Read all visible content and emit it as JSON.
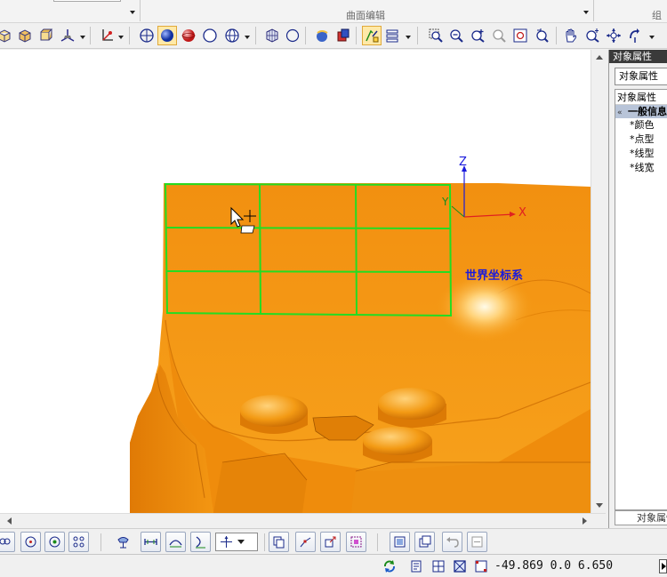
{
  "ribbon": {
    "group_surface_edit": "曲面编辑",
    "group_combine": "组合"
  },
  "toolbar": {
    "icons": [
      "box-wireframe-icon",
      "box-shaded-icon",
      "box-iso-icon",
      "axis-view-icon",
      "coordinate-system-icon",
      "render-icon",
      "sphere-shaded-icon",
      "sphere-red-icon",
      "sphere-outline-icon",
      "globe-icon",
      "cube-grid-icon",
      "sphere-small-icon",
      "texture-icon",
      "material-icon",
      "edit-select-icon",
      "layer-stack-icon",
      "zoom-window-icon",
      "zoom-out-icon",
      "zoom-in-icon",
      "zoom-disabled-icon",
      "zoom-fit-icon",
      "zoom-previous-icon",
      "pan-hand-icon",
      "dynamic-zoom-icon",
      "rotate-view-icon",
      "spin-view-icon"
    ],
    "active": "sphere-shaded-icon"
  },
  "viewport": {
    "coordinate_system_label": "世界坐标系",
    "axis_labels": {
      "z": "Z",
      "x": "X",
      "y": "Y"
    },
    "colors": {
      "part": "#f59a10",
      "grid": "#22dd22",
      "axis": "#1a1adc",
      "x_axis": "#e02020"
    }
  },
  "properties_panel": {
    "title": "对象属性",
    "tab_label": "对象属性",
    "header": "对象属性",
    "group_label": "一般信息",
    "items": [
      "*颜色",
      "*点型",
      "*线型",
      "*线宽"
    ],
    "bottom_tab": "对象属性"
  },
  "bottom_toolbar": {
    "icons": [
      "snap-points-icon",
      "snap-circle-icon",
      "snap-center-icon",
      "snap-grid-icon",
      "lamp-icon",
      "align-horizontal-icon",
      "align-curve-icon",
      "align-vertical-icon",
      "transform-combo-icon",
      "copy-icon",
      "node-edit-icon",
      "move-icon",
      "selection-icon",
      "view-icon",
      "window-icon",
      "undo-icon",
      "redo-icon"
    ]
  },
  "status_bar": {
    "coordinates": "-49.869 0.0 6.650",
    "icons": [
      "refresh-icon",
      "document-icon",
      "grid-toggle-icon",
      "box-toggle-icon",
      "ruler-icon"
    ]
  }
}
